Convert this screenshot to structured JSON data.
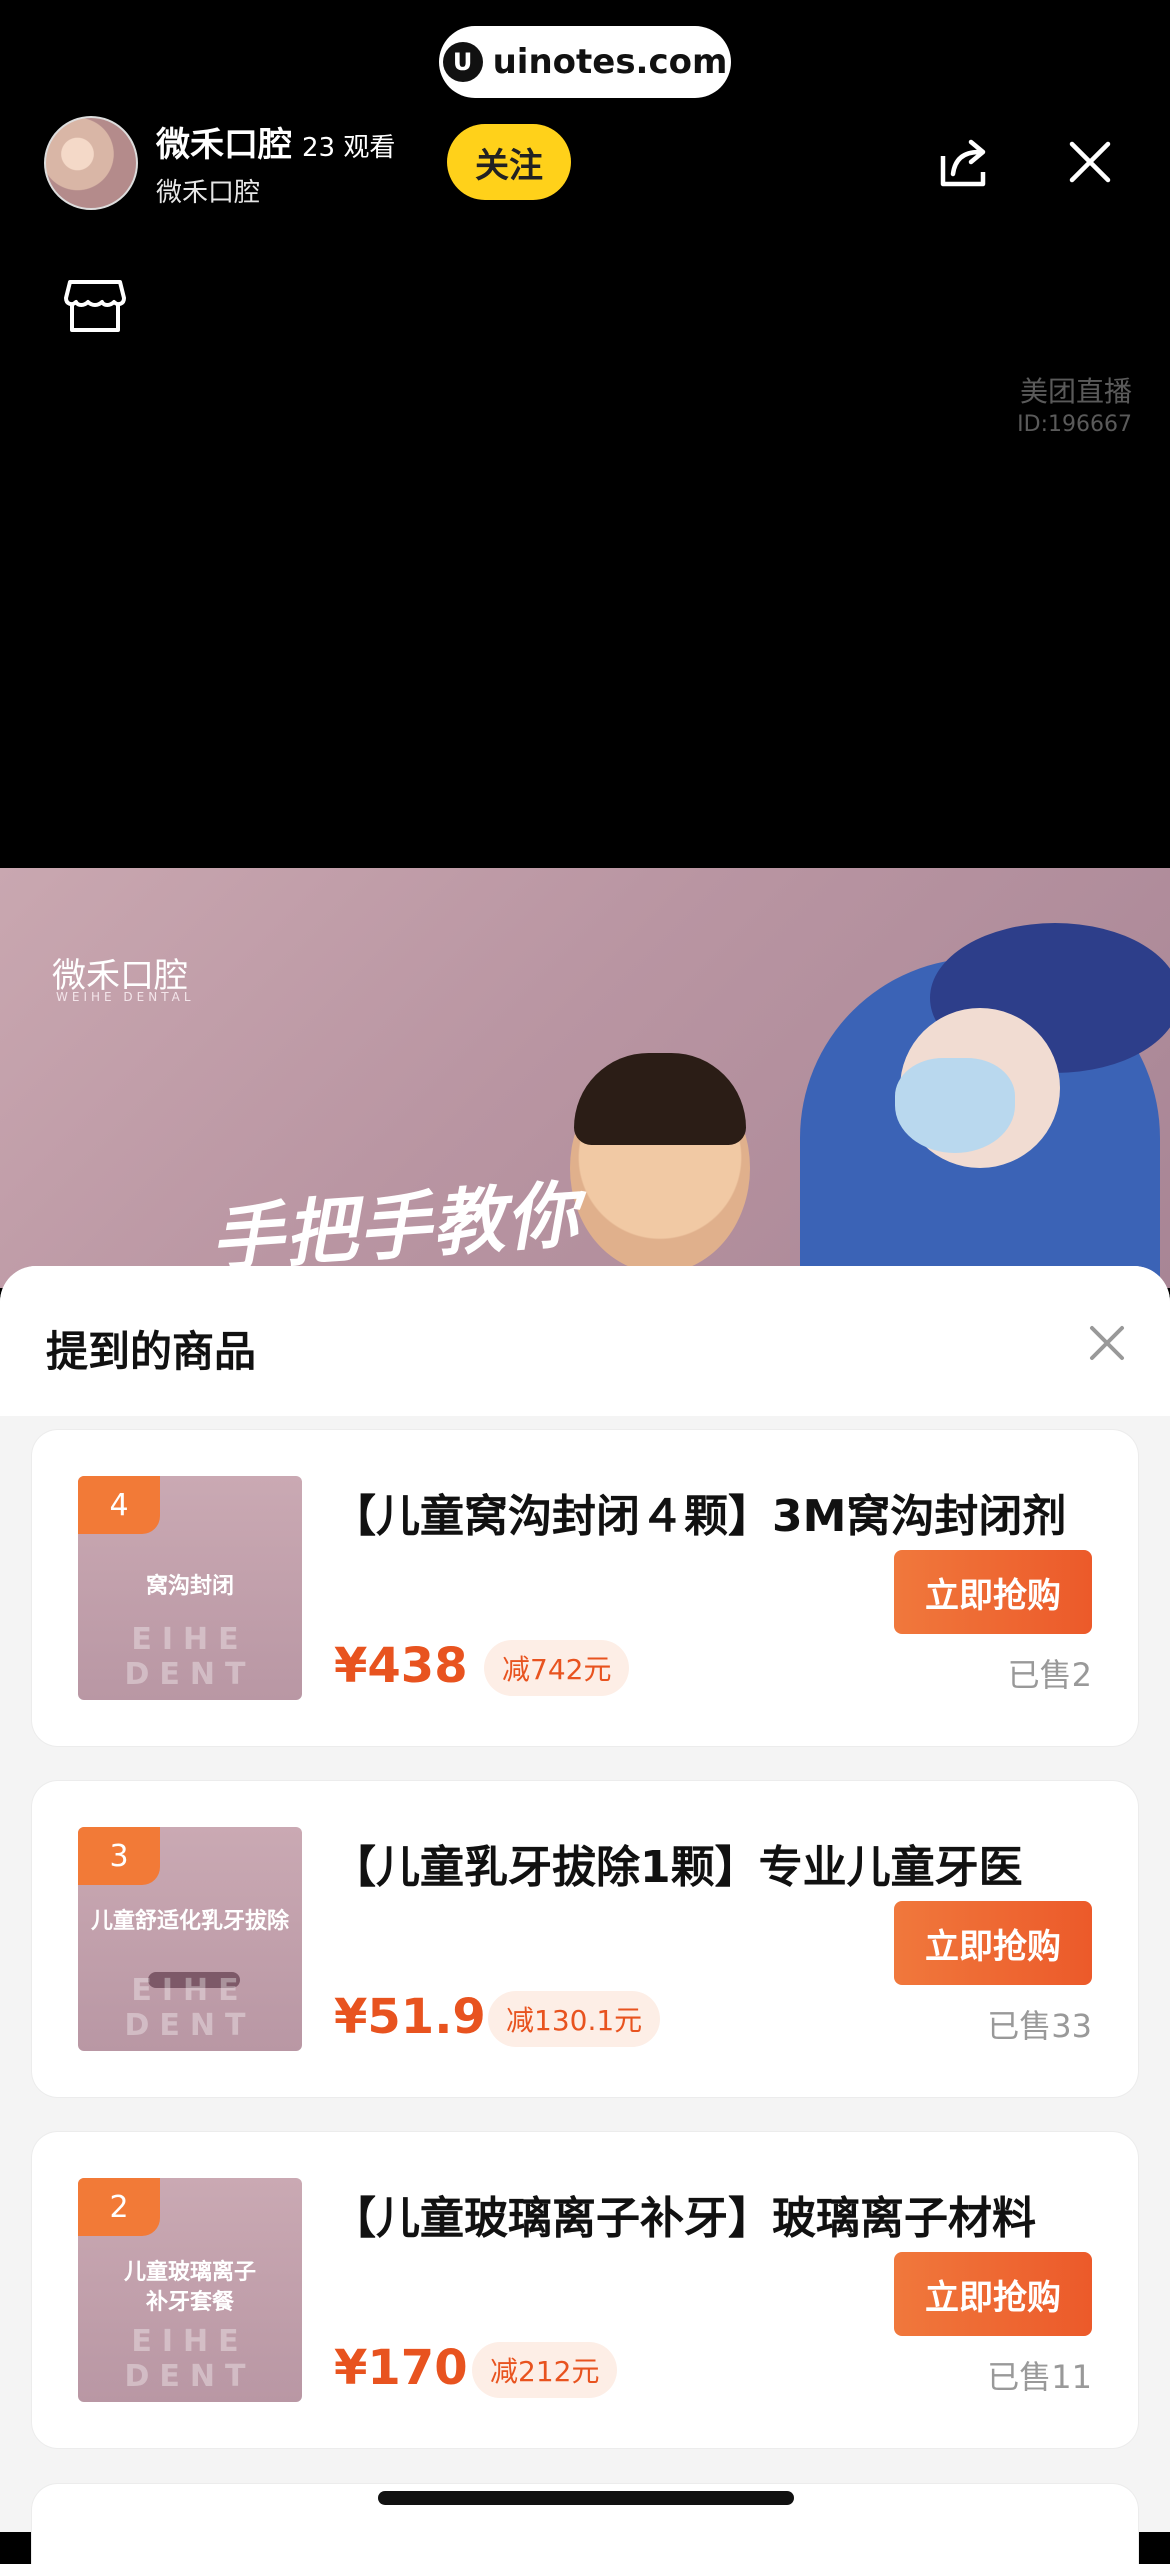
{
  "watermark": {
    "text": "uinotes.com",
    "logo": "U"
  },
  "host": {
    "name": "微禾口腔",
    "viewers": "23 观看",
    "subtitle": "微禾口腔"
  },
  "follow_label": "关注",
  "live_label": {
    "line1": "美团直播",
    "line2": "ID:196667"
  },
  "banner": {
    "brand": "微禾口腔",
    "brand_sub": "WEIHE DENTAL",
    "slogan": "手把手教你"
  },
  "sheet": {
    "title": "提到的商品"
  },
  "products": [
    {
      "rank": "4",
      "thumb_label": "窝沟封闭",
      "thumb_deco": "EIHE DENT",
      "title": "【儿童窝沟封闭４颗】3M窝沟封闭剂",
      "buy_label": "立即抢购",
      "price": "¥438",
      "discount": "减742元",
      "sold": "已售2"
    },
    {
      "rank": "3",
      "thumb_label": "儿童舒适化乳牙拔除",
      "thumb_deco": "EIHE DENT",
      "title": "【儿童乳牙拔除1颗】专业儿童牙医",
      "buy_label": "立即抢购",
      "price": "¥51.9",
      "discount": "减130.1元",
      "sold": "已售33"
    },
    {
      "rank": "2",
      "thumb_label": "儿童玻璃离子\n补牙套餐",
      "thumb_deco": "EIHE DENT",
      "title": "【儿童玻璃离子补牙】玻璃离子材料",
      "buy_label": "立即抢购",
      "price": "¥170",
      "discount": "减212元",
      "sold": "已售11"
    }
  ],
  "colors": {
    "accent": "#ec5a2a",
    "follow": "#ffd11a",
    "price": "#e8531f"
  },
  "icons": [
    "share-icon",
    "close-icon",
    "store-icon",
    "close-icon"
  ]
}
